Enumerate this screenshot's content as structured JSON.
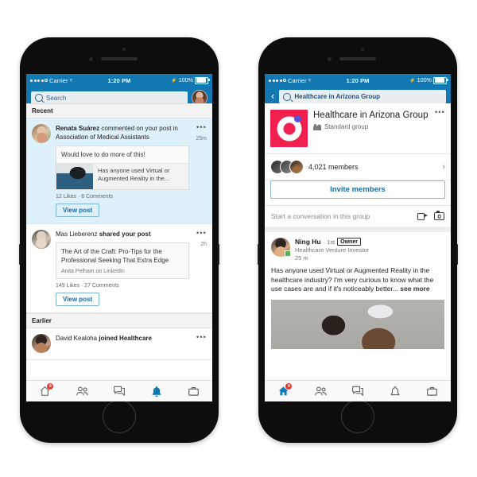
{
  "meta": {
    "accent_blue": "#1178b3",
    "link_blue": "#1a6ca8",
    "unread_bg": "#def1fb",
    "badge_red": "#e8392f",
    "group_pink": "#f2204e",
    "group_purple": "#5b4fd4"
  },
  "status_bar": {
    "carrier": "Carrier",
    "time": "1:20 PM",
    "battery_percent": "100%",
    "wifi_icon": "wifi-icon",
    "battery_icon": "battery-icon",
    "charging_icon": "bolt-icon"
  },
  "left_phone": {
    "search": {
      "placeholder": "Search",
      "icon": "search-icon",
      "avatar": "profile-avatar"
    },
    "sections": [
      {
        "title": "Recent",
        "notifications": [
          {
            "avatar": "renata-avatar",
            "actor": "Renata Suárez",
            "action": " commented on your post in Association of Medical Assistants",
            "time": "25m",
            "unread": true,
            "quote": {
              "comment": "Would love to do more of this!",
              "caption": "Has anyone used Virtual or Augmented Reality in the...",
              "thumb": "vr-post-thumbnail"
            },
            "stats": "12 Likes  ·  6 Comments",
            "cta": "View post",
            "menu_icon": "more-options-icon"
          },
          {
            "avatar": "mas-avatar",
            "actor": "Mas Lieberenz",
            "action": " shared your post",
            "time": "2h",
            "unread": false,
            "quote": {
              "comment": "The Art of the Craft: Pro-Tips for the Professional Seeking That Extra Edge",
              "subtitle": "Anita Pelham on LinkedIn"
            },
            "stats": "149 Likes  ·  27 Comments",
            "cta": "View post",
            "menu_icon": "more-options-icon"
          }
        ]
      },
      {
        "title": "Earlier",
        "notifications": [
          {
            "avatar": "david-avatar",
            "actor": "David Kealoha",
            "action": " joined Healthcare",
            "time": "",
            "unread": false,
            "menu_icon": "more-options-icon"
          }
        ]
      }
    ],
    "tabs": [
      {
        "name": "home",
        "icon": "home-icon",
        "active": false,
        "badge": "9"
      },
      {
        "name": "network",
        "icon": "people-icon",
        "active": false
      },
      {
        "name": "messaging",
        "icon": "chat-icon",
        "active": false
      },
      {
        "name": "notifications",
        "icon": "bell-icon",
        "active": true
      },
      {
        "name": "jobs",
        "icon": "briefcase-icon",
        "active": false
      }
    ]
  },
  "right_phone": {
    "search": {
      "back_icon": "back-chevron-icon",
      "icon": "search-icon",
      "value": "Healthcare in Arizona Group"
    },
    "group": {
      "logo": "group-logo",
      "name": "Healthcare in Arizona Group",
      "type": "Standard group",
      "type_icon": "people-icon",
      "menu_icon": "more-options-icon",
      "members_count": "4,021 members",
      "members_chevron": "chevron-right-icon",
      "invite_label": "Invite members"
    },
    "composer": {
      "placeholder": "Start a conversation in this group",
      "video_icon": "video-icon",
      "camera_icon": "camera-icon"
    },
    "post": {
      "avatar": "ning-hu-avatar",
      "author": "Ning Hu",
      "degree": "· 1st",
      "badge": "Owner",
      "headline": "Healthcare Venture Investor",
      "time": "25 m",
      "presence_icon": "online-indicator-icon",
      "text": "Has anyone used Virtual or Augmented Reality in the healthcare industry? I'm very curious to know what the use cases are and if it's noticeably better...",
      "see_more": " see more",
      "image": "vr-headset-photo"
    },
    "tabs": [
      {
        "name": "home",
        "icon": "home-icon",
        "active": true,
        "badge": "9"
      },
      {
        "name": "network",
        "icon": "people-icon",
        "active": false
      },
      {
        "name": "messaging",
        "icon": "chat-icon",
        "active": false
      },
      {
        "name": "notifications",
        "icon": "bell-icon",
        "active": false
      },
      {
        "name": "jobs",
        "icon": "briefcase-icon",
        "active": false
      }
    ]
  }
}
